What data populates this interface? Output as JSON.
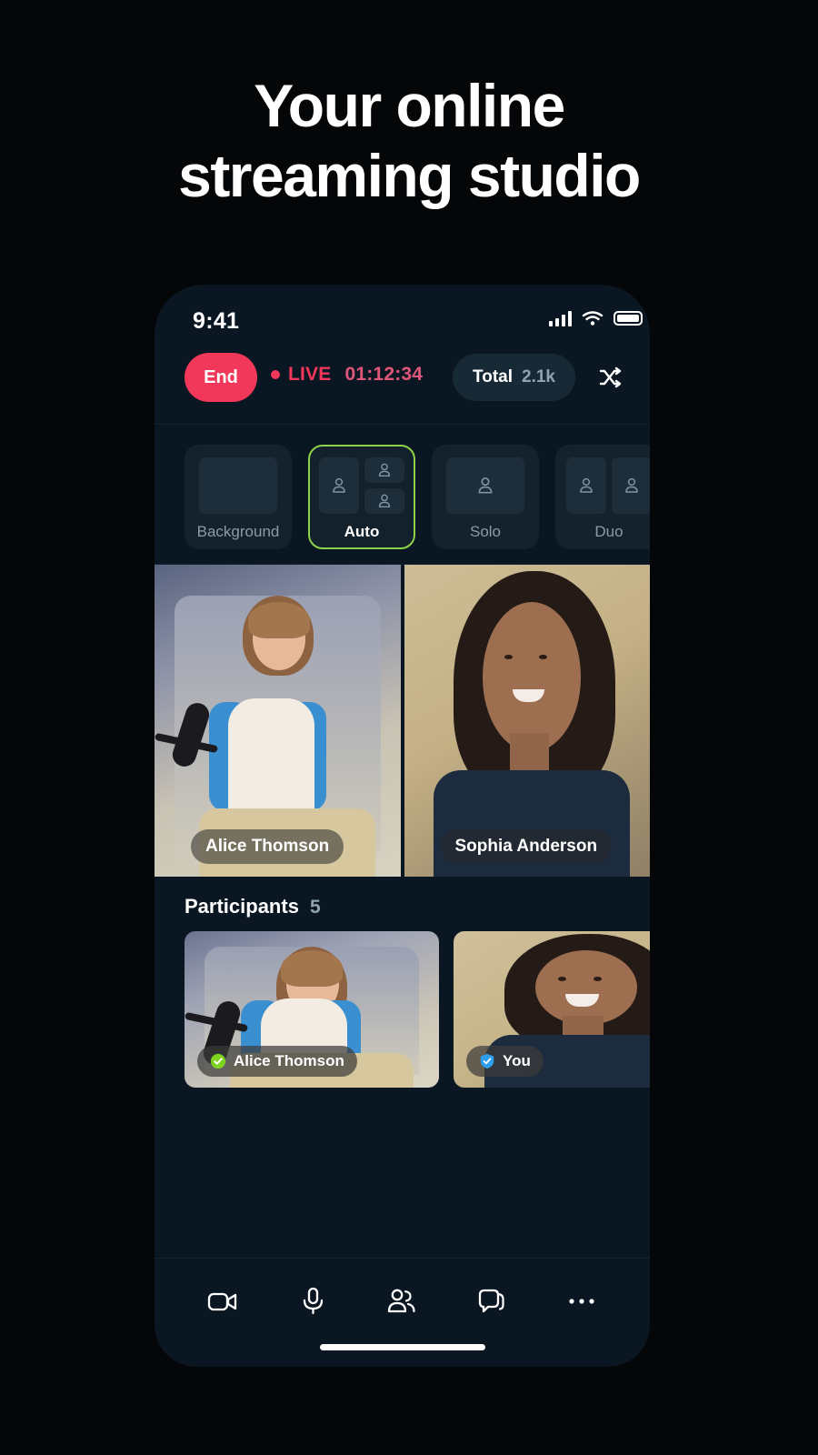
{
  "headline": {
    "line1": "Your online",
    "line2": "streaming studio"
  },
  "phone": {
    "status_bar": {
      "time": "9:41",
      "signal_icon": "cellular-bars-icon",
      "wifi_icon": "wifi-icon",
      "battery_icon": "battery-icon"
    },
    "live_bar": {
      "end_label": "End",
      "live_label": "LIVE",
      "timer": "01:12:34",
      "total_label": "Total",
      "total_value": "2.1k",
      "shuffle_icon": "shuffle-icon",
      "live_color": "#f2385a",
      "end_button_color": "#f2385a"
    },
    "layouts": {
      "selected": "Auto",
      "selected_color": "#8fd24a",
      "items": [
        {
          "label": "Background",
          "type": "background"
        },
        {
          "label": "Auto",
          "type": "auto"
        },
        {
          "label": "Solo",
          "type": "solo"
        },
        {
          "label": "Duo",
          "type": "duo"
        }
      ]
    },
    "stage": {
      "tiles": [
        {
          "name": "Alice Thomson"
        },
        {
          "name": "Sophia Anderson"
        }
      ]
    },
    "participants": {
      "title": "Participants",
      "count": "5",
      "items": [
        {
          "name": "Alice Thomson",
          "badge_icon": "verified-shield-icon",
          "badge_color": "#7ed321"
        },
        {
          "name": "You",
          "badge_icon": "verified-shield-icon",
          "badge_color": "#2e9ff0"
        }
      ]
    },
    "toolbar": {
      "buttons": [
        {
          "icon": "video-camera-icon",
          "label": "Camera"
        },
        {
          "icon": "microphone-icon",
          "label": "Microphone"
        },
        {
          "icon": "people-icon",
          "label": "Participants"
        },
        {
          "icon": "chat-bubble-icon",
          "label": "Chat"
        },
        {
          "icon": "more-dots-icon",
          "label": "More"
        }
      ]
    }
  }
}
